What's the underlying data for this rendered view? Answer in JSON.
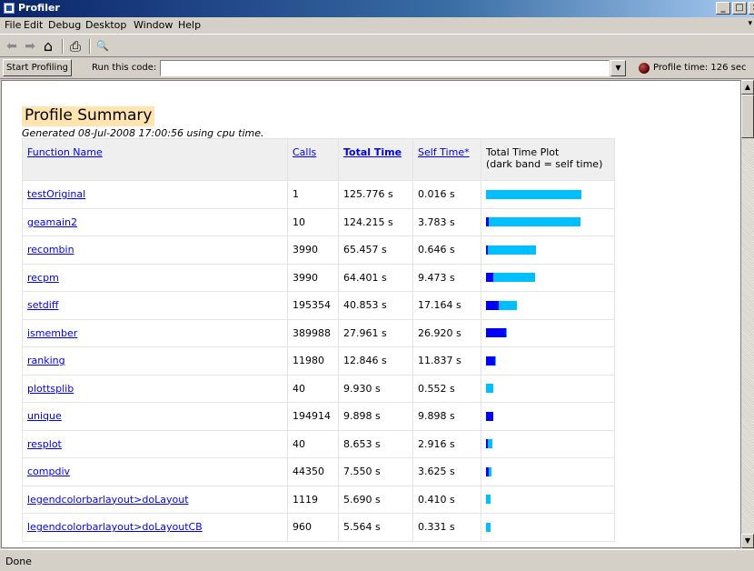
{
  "window": {
    "title": "Profiler",
    "min_glyph": "_",
    "max_glyph": "□",
    "close_glyph": "×"
  },
  "menu": [
    {
      "label": "File"
    },
    {
      "label": "Edit"
    },
    {
      "label": "Debug"
    },
    {
      "label": "Desktop"
    },
    {
      "label": "Window"
    },
    {
      "label": "Help"
    }
  ],
  "menu_dock_glyph": "▾",
  "toolbar": {
    "back": "⬅",
    "forward": "➡",
    "home": "⌂",
    "print": "⎙",
    "find": "🔍"
  },
  "codebar": {
    "start_label": "Start Profiling",
    "run_label": "Run this code:",
    "code_value": "",
    "dropdown_glyph": "▼",
    "profile_time": "Profile time: 126 sec"
  },
  "summary": {
    "title": "Profile Summary",
    "generated": "Generated 08-Jul-2008 17:00:56 using cpu time."
  },
  "columns": {
    "name": "Function Name",
    "calls": "Calls",
    "total": "Total Time",
    "self": "Self Time*",
    "plot_line1": "Total Time Plot",
    "plot_line2": "(dark band = self time)"
  },
  "colors": {
    "total_bar": "#00bfff",
    "self_bar": "#0000ff",
    "link": "#0000ee"
  },
  "rows": [
    {
      "name": "testOriginal",
      "calls": "1",
      "total": "125.776 s",
      "self": "0.016 s",
      "total_s": 125.776,
      "self_s": 0.016
    },
    {
      "name": "geamain2",
      "calls": "10",
      "total": "124.215 s",
      "self": "3.783 s",
      "total_s": 124.215,
      "self_s": 3.783
    },
    {
      "name": "recombin",
      "calls": "3990",
      "total": "65.457 s",
      "self": "0.646 s",
      "total_s": 65.457,
      "self_s": 0.646
    },
    {
      "name": "recpm",
      "calls": "3990",
      "total": "64.401 s",
      "self": "9.473 s",
      "total_s": 64.401,
      "self_s": 9.473
    },
    {
      "name": "setdiff",
      "calls": "195354",
      "total": "40.853 s",
      "self": "17.164 s",
      "total_s": 40.853,
      "self_s": 17.164
    },
    {
      "name": "ismember",
      "calls": "389988",
      "total": "27.961 s",
      "self": "26.920 s",
      "total_s": 27.961,
      "self_s": 26.92
    },
    {
      "name": "ranking",
      "calls": "11980",
      "total": "12.846 s",
      "self": "11.837 s",
      "total_s": 12.846,
      "self_s": 11.837
    },
    {
      "name": "plottsplib",
      "calls": "40",
      "total": "9.930 s",
      "self": "0.552 s",
      "total_s": 9.93,
      "self_s": 0.552
    },
    {
      "name": "unique",
      "calls": "194914",
      "total": "9.898 s",
      "self": "9.898 s",
      "total_s": 9.898,
      "self_s": 9.898
    },
    {
      "name": "resplot",
      "calls": "40",
      "total": "8.653 s",
      "self": "2.916 s",
      "total_s": 8.653,
      "self_s": 2.916
    },
    {
      "name": "compdiv",
      "calls": "44350",
      "total": "7.550 s",
      "self": "3.625 s",
      "total_s": 7.55,
      "self_s": 3.625
    },
    {
      "name": "legendcolorbarlayout>doLayout",
      "calls": "1119",
      "total": "5.690 s",
      "self": "0.410 s",
      "total_s": 5.69,
      "self_s": 0.41
    },
    {
      "name": "legendcolorbarlayout>doLayoutCB",
      "calls": "960",
      "total": "5.564 s",
      "self": "0.331 s",
      "total_s": 5.564,
      "self_s": 0.331
    }
  ],
  "scrollbar": {
    "up": "▲",
    "down": "▼"
  },
  "status": "Done"
}
